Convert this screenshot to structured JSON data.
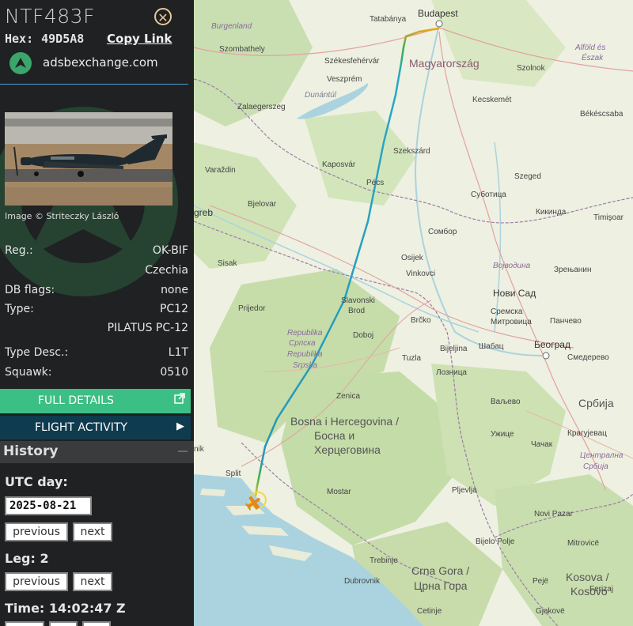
{
  "aircraft": {
    "callsign": "NTF483F",
    "hex_label": "Hex:",
    "hex": "49D5A8",
    "copy_link": "Copy Link",
    "source_site": "adsbexchange.com",
    "image_credit": "Image © Striteczky László"
  },
  "details": {
    "reg_label": "Reg.:",
    "reg": "OK-BIF",
    "country": "Czechia",
    "dbflags_label": "DB flags:",
    "dbflags": "none",
    "type_label": "Type:",
    "type": "PC12",
    "type_full": "PILATUS PC-12",
    "typedesc_label": "Type Desc.:",
    "typedesc": "L1T",
    "squawk_label": "Squawk:",
    "squawk": "0510"
  },
  "buttons": {
    "full_details": "FULL DETAILS",
    "flight_activity": "FLIGHT ACTIVITY"
  },
  "history": {
    "title": "History",
    "utc_day_label": "UTC day:",
    "utc_day": "2025-08-21",
    "previous": "previous",
    "next": "next",
    "leg_label": "Leg: 2",
    "time_label": "Time: 14:02:47 Z"
  },
  "map": {
    "labels": {
      "budapest": "Budapest",
      "tatabanya": "Tatabánya",
      "burgenland": "Burgenland",
      "szombathely": "Szombathely",
      "szekesfehervar": "Székesfehérvár",
      "magyarorszag": "Magyarország",
      "veszprem": "Veszprém",
      "szolnok": "Szolnok",
      "alfold1": "Alföld és",
      "alfold2": "Észak",
      "dunantul": "Dunántúl",
      "kecskemet": "Kecskemét",
      "zalaegerszeg": "Zalaegerszeg",
      "bekescsaba": "Békéscsaba",
      "szekszard": "Szekszárd",
      "varazdin": "Varaždin",
      "kaposvar": "Kaposvár",
      "szeged": "Szeged",
      "pecs": "Pécs",
      "subotica": "Суботица",
      "zagreb": "greb",
      "bjelovar": "Bjelovar",
      "kikinda": "Кикинда",
      "timisoara": "Timişoar",
      "sombor": "Сомбор",
      "sisak": "Sisak",
      "osijek": "Osijek",
      "vojvodina": "Војводина",
      "zrenjanin": "Зрењанин",
      "vinkovci": "Vinkovci",
      "prijedor": "Prijedor",
      "novisad": "Нови Сад",
      "slavonski1": "Slavonski",
      "slavonski2": "Brod",
      "sremska1": "Сремска",
      "sremska2": "Митровица",
      "pancevo": "Панчево",
      "brcko": "Brčko",
      "rs1": "Republika",
      "rs2": "Српска",
      "rs3": "Republika",
      "rs4": "Srpska",
      "doboj": "Doboj",
      "bijeljina": "Bijeljina",
      "sabac": "Шабац",
      "beograd": "Београд",
      "smederevo": "Смедерево",
      "tuzla": "Tuzla",
      "loznica": "Лозница",
      "zenica": "Zenica",
      "valjevo": "Ваљево",
      "srbija": "Србија",
      "bih1": "Bosna i Hercegovina /",
      "bih2": "Босна и",
      "bih3": "Херцеговина",
      "uzice": "Ужице",
      "kragujevac": "Крагујевац",
      "split": "Split",
      "cacak": "Чачак",
      "nik": "nik",
      "centralna1": "Централна",
      "centralna2": "Србија",
      "mostar": "Mostar",
      "pljevlja": "Pljevlja",
      "novipazar": "Novi Pazar",
      "bijelopolje": "Bijelo Polje",
      "mitrovice": "Mitrovicë",
      "trebinje": "Trebinje",
      "crnagora1": "Crna Gora /",
      "crnagora2": "Црна Гора",
      "kosova1": "Kosova /",
      "kosova2": "Kosovo",
      "dubrovnik": "Dubrovnik",
      "peje": "Pejë",
      "ferizaj": "Ferizaj",
      "cetinje": "Cetinje",
      "gjakove": "Gjakovë"
    }
  }
}
